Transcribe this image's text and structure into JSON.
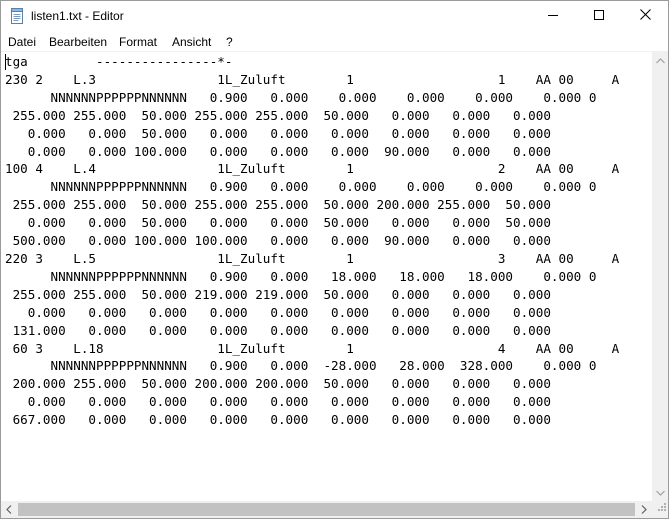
{
  "window": {
    "title": "listen1.txt - Editor",
    "controls": {
      "minimize": "minimize",
      "maximize": "maximize",
      "close": "close"
    }
  },
  "menu": {
    "items": [
      "Datei",
      "Bearbeiten",
      "Format",
      "Ansicht",
      "?"
    ]
  },
  "editor": {
    "lines": [
      "tga         ----------------*-",
      "230 2    L.3                1L_Zuluft        1                   1    AA 00     A",
      "      NNNNNNPPPPPPNNNNNN   0.900   0.000    0.000    0.000    0.000    0.000 0",
      " 255.000 255.000  50.000 255.000 255.000  50.000   0.000   0.000   0.000",
      "   0.000   0.000  50.000   0.000   0.000   0.000   0.000   0.000   0.000",
      "   0.000   0.000 100.000   0.000   0.000   0.000  90.000   0.000   0.000",
      "100 4    L.4                1L_Zuluft        1                   2    AA 00     A",
      "      NNNNNNPPPPPPNNNNNN   0.900   0.000    0.000    0.000    0.000    0.000 0",
      " 255.000 255.000  50.000 255.000 255.000  50.000 200.000 255.000  50.000",
      "   0.000   0.000  50.000   0.000   0.000  50.000   0.000   0.000  50.000",
      " 500.000   0.000 100.000 100.000   0.000   0.000  90.000   0.000   0.000",
      "220 3    L.5                1L_Zuluft        1                   3    AA 00     A",
      "      NNNNNNPPPPPPNNNNNN   0.900   0.000   18.000   18.000   18.000    0.000 0",
      " 255.000 255.000  50.000 219.000 219.000  50.000   0.000   0.000   0.000",
      "   0.000   0.000   0.000   0.000   0.000   0.000   0.000   0.000   0.000",
      " 131.000   0.000   0.000   0.000   0.000   0.000   0.000   0.000   0.000",
      " 60 3    L.18               1L_Zuluft        1                   4    AA 00     A",
      "      NNNNNNPPPPPPNNNNNN   0.900   0.000  -28.000   28.000  328.000    0.000 0",
      " 200.000 255.000  50.000 200.000 200.000  50.000   0.000   0.000   0.000",
      "   0.000   0.000   0.000   0.000   0.000   0.000   0.000   0.000   0.000",
      " 667.000   0.000   0.000   0.000   0.000   0.000   0.000   0.000   0.000"
    ]
  },
  "icons": {
    "app": "notepad-icon",
    "scroll_up": "arrow-up-icon",
    "scroll_down": "arrow-down-icon",
    "scroll_left": "arrow-left-icon",
    "scroll_right": "arrow-right-icon",
    "resize": "size-grip-icon"
  },
  "colors": {
    "background": "#ffffff",
    "scrollbar_track": "#f0f0f0",
    "scrollbar_thumb": "#c2c2c2",
    "text": "#000000"
  }
}
